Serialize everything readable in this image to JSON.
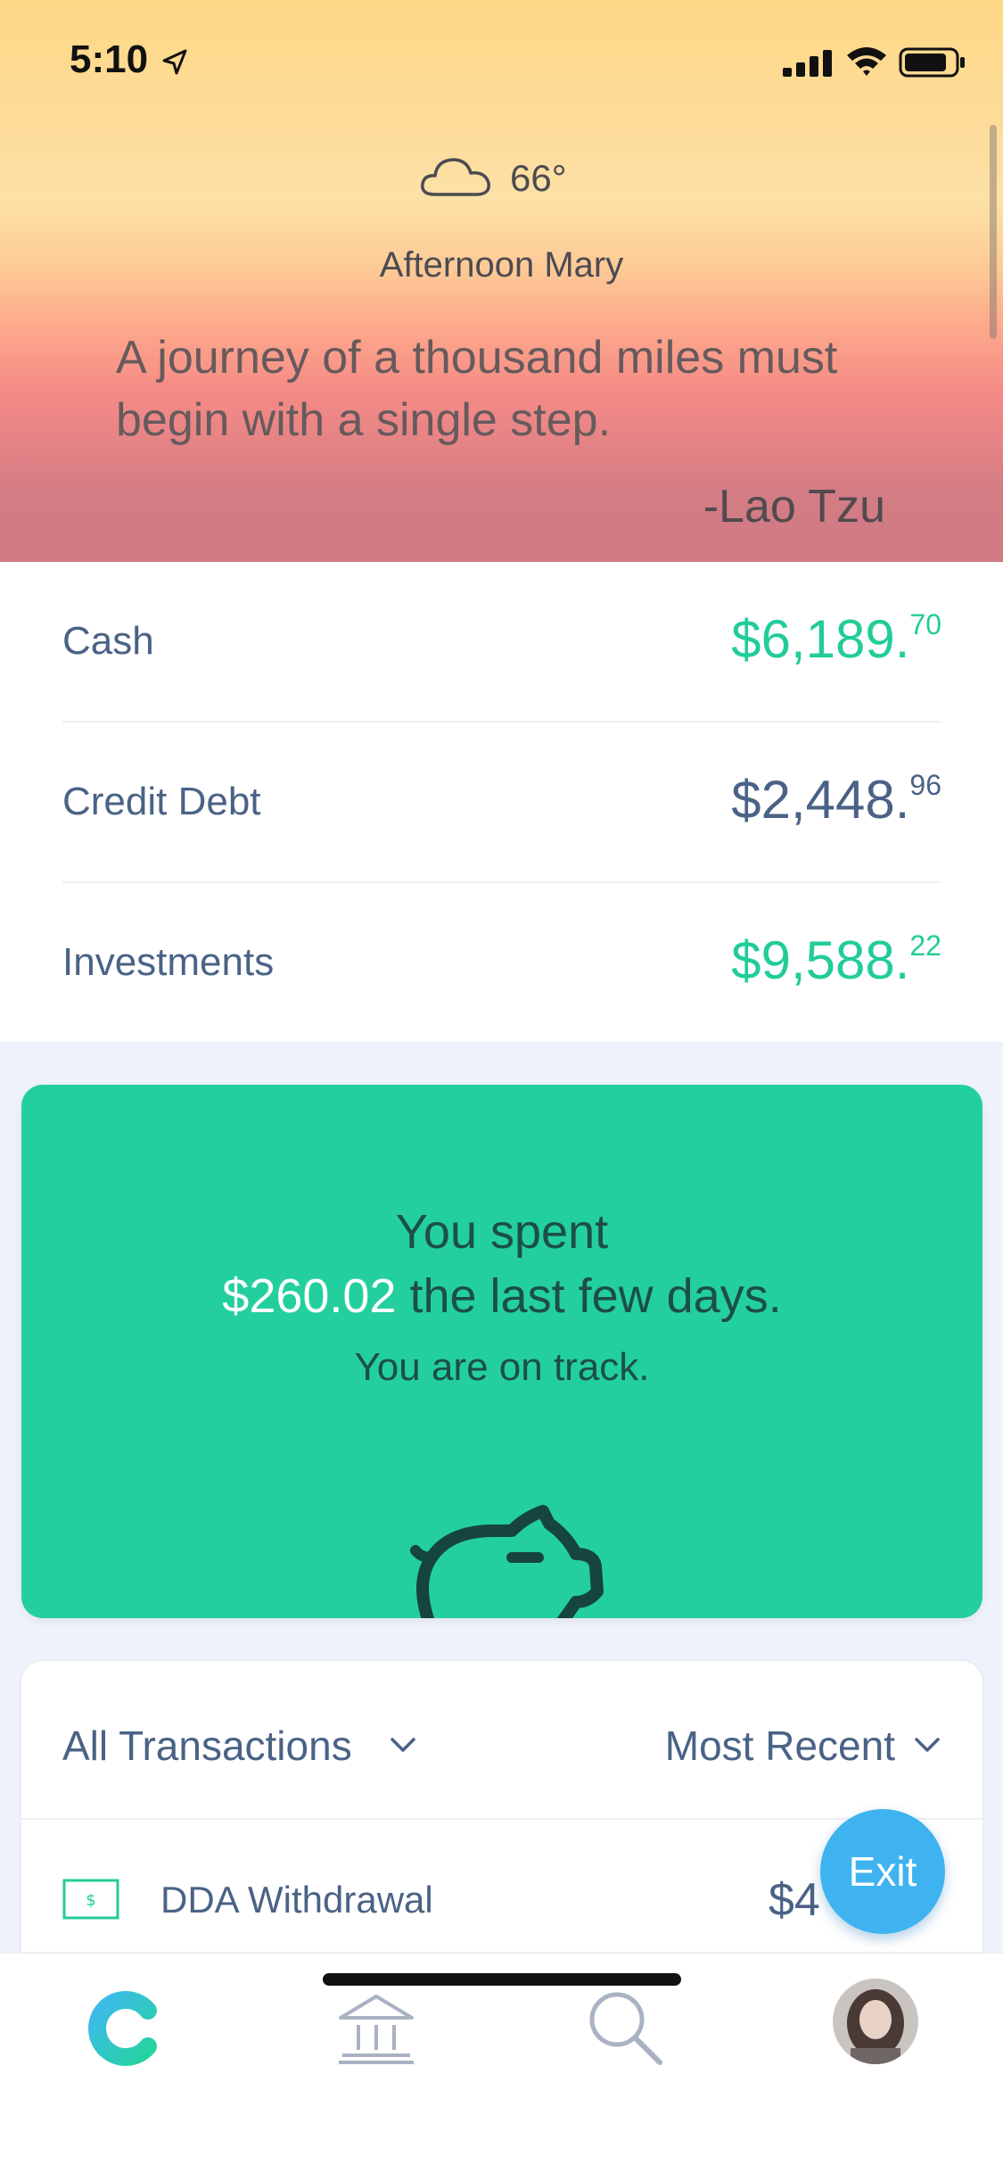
{
  "status_bar": {
    "time": "5:10",
    "icons": [
      "location-arrow-icon",
      "signal-icon",
      "wifi-icon",
      "battery-icon"
    ]
  },
  "header": {
    "weather_icon": "cloud-icon",
    "temperature": "66°",
    "greeting": "Afternoon Mary",
    "quote": "A journey of a thousand miles must begin with a single step.",
    "quote_author": "-Lao Tzu"
  },
  "balances": [
    {
      "label": "Cash",
      "whole": "$6,189.",
      "cents": "70",
      "color": "#22cc9a"
    },
    {
      "label": "Credit Debt",
      "whole": "$2,448.",
      "cents": "96",
      "color": "#4a6286"
    },
    {
      "label": "Investments",
      "whole": "$9,588.",
      "cents": "22",
      "color": "#22cc9a"
    }
  ],
  "spent_card": {
    "line1": "You spent",
    "amount": "$260.02",
    "line2_rest": " the last few days.",
    "status": "You are on track.",
    "icon": "piggy-bank-icon",
    "color": "#24cf9f"
  },
  "transactions": {
    "filter_label": "All Transactions",
    "sort_label": "Most Recent",
    "rows": [
      {
        "icon": "cash-icon",
        "name": "DDA Withdrawal",
        "amount": "$4"
      }
    ]
  },
  "exit_button": {
    "label": "Exit",
    "color": "#3fb3f0"
  },
  "tab_bar": {
    "tabs": [
      "home-logo-icon",
      "bank-icon",
      "search-icon",
      "profile-avatar"
    ]
  }
}
